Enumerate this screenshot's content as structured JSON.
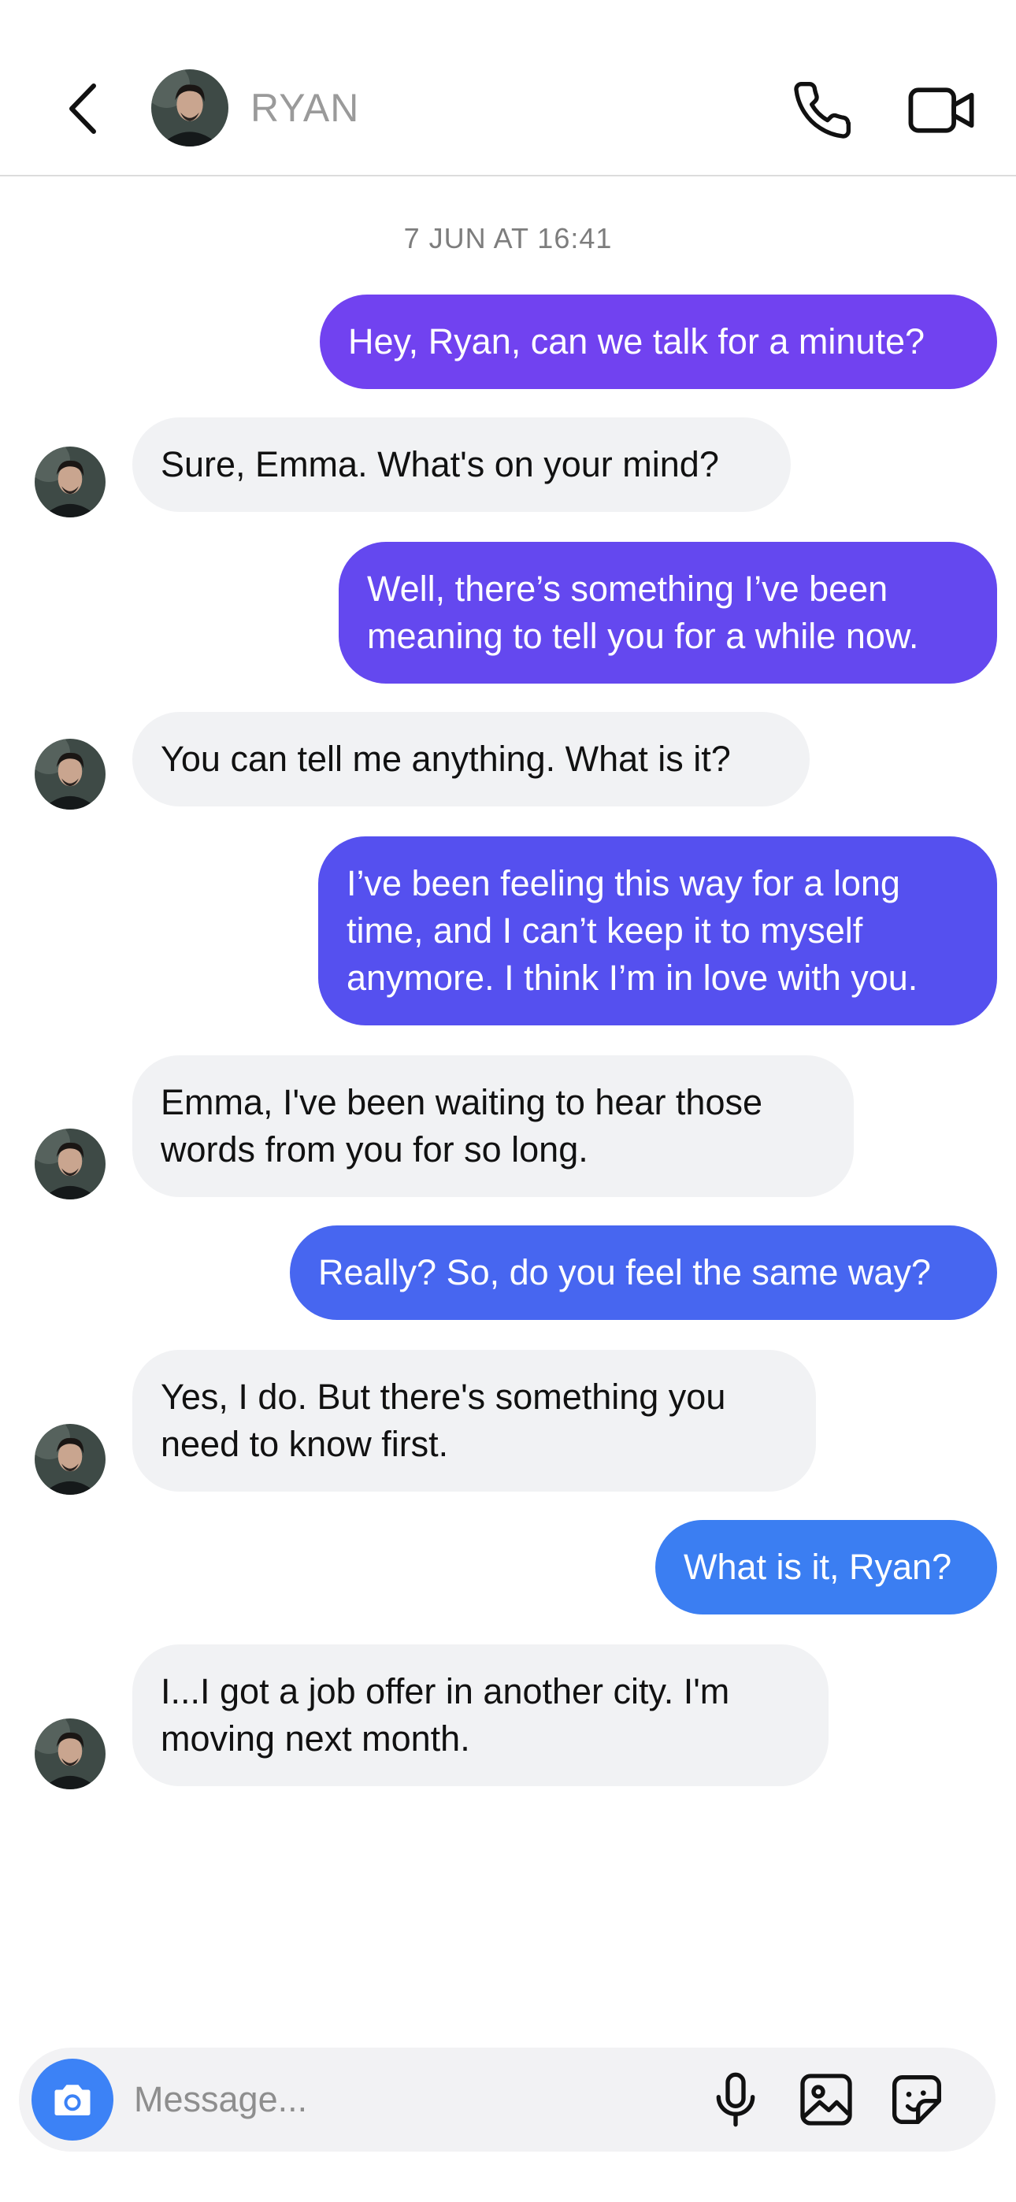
{
  "header": {
    "contact_name": "RYAN",
    "back_icon": "chevron-left-icon",
    "call_icon": "phone-icon",
    "video_icon": "video-camera-icon"
  },
  "conversation": {
    "timestamp": "7 JUN AT 16:41",
    "messages": [
      {
        "direction": "outgoing",
        "text": "Hey, Ryan, can we talk for a minute?"
      },
      {
        "direction": "incoming",
        "text": "Sure, Emma. What's on your mind?"
      },
      {
        "direction": "outgoing",
        "text": "Well, there’s something I’ve been\nmeaning to tell you for a while now."
      },
      {
        "direction": "incoming",
        "text": "You can tell me anything. What is it?"
      },
      {
        "direction": "outgoing",
        "text": "I’ve been feeling this way for a long\ntime, and I can’t keep it to myself\nanymore. I think I’m in love with you."
      },
      {
        "direction": "incoming",
        "text": "Emma, I've been waiting to hear those\nwords from you for so long."
      },
      {
        "direction": "outgoing",
        "text": "Really? So, do you feel the same way?"
      },
      {
        "direction": "incoming",
        "text": "Yes, I do. But there's something you\nneed to know first."
      },
      {
        "direction": "outgoing",
        "text": "What is it, Ryan?"
      },
      {
        "direction": "incoming",
        "text": "I...I got a job offer in another city. I'm\nmoving next month."
      }
    ]
  },
  "composer": {
    "placeholder": "Message...",
    "value": "",
    "camera_icon": "camera-icon",
    "mic_icon": "microphone-icon",
    "gallery_icon": "image-icon",
    "sticker_icon": "sticker-icon"
  },
  "colors": {
    "outgoing_gradient_top": "#7440f0",
    "outgoing_gradient_bottom": "#3b7ef2",
    "incoming_bubble": "#f1f2f4",
    "camera_button": "#3c82f6"
  }
}
